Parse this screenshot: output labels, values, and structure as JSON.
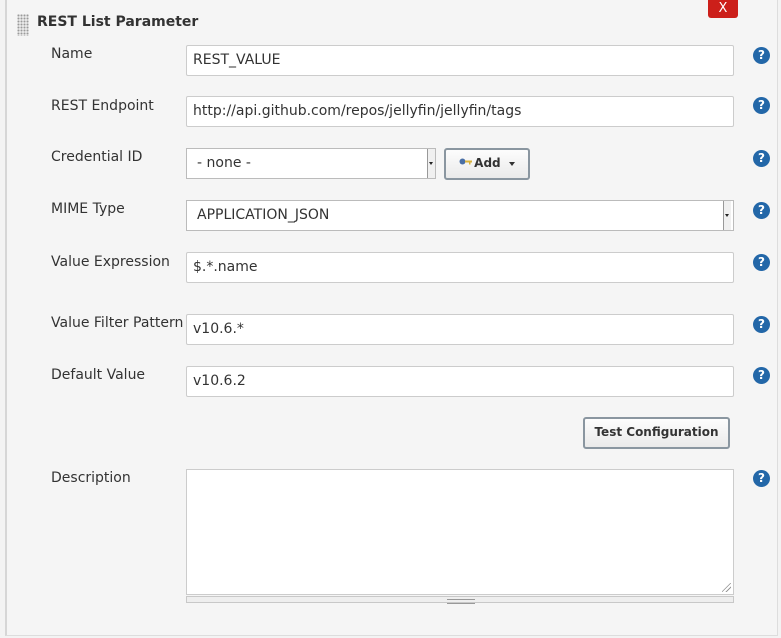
{
  "section": {
    "title": "REST List Parameter",
    "close_label": "X"
  },
  "help_label": "?",
  "fields": {
    "name": {
      "label": "Name",
      "value": "REST_VALUE"
    },
    "rest_endpoint": {
      "label": "REST Endpoint",
      "value": "http://api.github.com/repos/jellyfin/jellyfin/tags"
    },
    "credential_id": {
      "label": "Credential ID",
      "selected": "- none -",
      "add_label": "Add"
    },
    "mime_type": {
      "label": "MIME Type",
      "selected": "APPLICATION_JSON"
    },
    "value_expression": {
      "label": "Value Expression",
      "value": "$.*.name"
    },
    "value_filter_pattern": {
      "label": "Value Filter Pattern",
      "value": "v10.6.*"
    },
    "default_value": {
      "label": "Default Value",
      "value": "v10.6.2"
    },
    "description": {
      "label": "Description",
      "value": ""
    }
  },
  "test_button_label": "Test Configuration",
  "colors": {
    "close_button": "#cc1f1a",
    "help_icon": "#2367a8"
  }
}
